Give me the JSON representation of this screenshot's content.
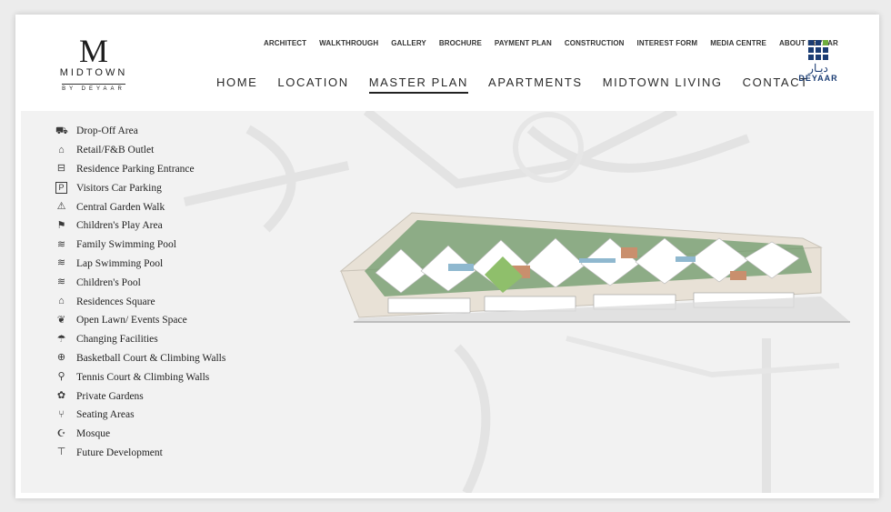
{
  "logo": {
    "mark": "M",
    "word": "MIDTOWN",
    "sub": "BY DEYAAR"
  },
  "top_nav": [
    {
      "label": "ARCHITECT"
    },
    {
      "label": "WALKTHROUGH"
    },
    {
      "label": "GALLERY"
    },
    {
      "label": "BROCHURE"
    },
    {
      "label": "PAYMENT PLAN"
    },
    {
      "label": "CONSTRUCTION"
    },
    {
      "label": "INTEREST FORM"
    },
    {
      "label": "MEDIA CENTRE"
    },
    {
      "label": "ABOUT DEYAAR"
    }
  ],
  "main_nav": [
    {
      "label": "HOME"
    },
    {
      "label": "LOCATION"
    },
    {
      "label": "MASTER PLAN",
      "active": true
    },
    {
      "label": "APARTMENTS"
    },
    {
      "label": "MIDTOWN LIVING"
    },
    {
      "label": "CONTACT"
    }
  ],
  "brand": {
    "arabic": "ديـار",
    "name": "DEYAAR",
    "primary_color": "#1a3c73",
    "accent_color": "#6fae3d"
  },
  "legend": [
    {
      "icon": "car-icon",
      "glyph": "⛟",
      "label": "Drop-Off Area"
    },
    {
      "icon": "shopping-bag-icon",
      "glyph": "⌂",
      "label": "Retail/F&B Outlet"
    },
    {
      "icon": "barrier-icon",
      "glyph": "⊟",
      "label": "Residence Parking Entrance"
    },
    {
      "icon": "parking-icon",
      "glyph": "P",
      "label": "Visitors Car Parking"
    },
    {
      "icon": "tree-icon",
      "glyph": "⚠",
      "label": "Central Garden Walk"
    },
    {
      "icon": "running-child-icon",
      "glyph": "⚑",
      "label": "Children's Play Area"
    },
    {
      "icon": "waves-icon",
      "glyph": "≋",
      "label": "Family Swimming Pool"
    },
    {
      "icon": "waves-icon",
      "glyph": "≋",
      "label": "Lap Swimming Pool"
    },
    {
      "icon": "waves-icon",
      "glyph": "≋",
      "label": "Children's Pool"
    },
    {
      "icon": "house-icon",
      "glyph": "⌂",
      "label": "Residences Square"
    },
    {
      "icon": "leaf-icon",
      "glyph": "❦",
      "label": "Open Lawn/ Events Space"
    },
    {
      "icon": "shower-icon",
      "glyph": "☂",
      "label": "Changing Facilities"
    },
    {
      "icon": "basketball-icon",
      "glyph": "⊕",
      "label": "Basketball Court & Climbing Walls"
    },
    {
      "icon": "tennis-racket-icon",
      "glyph": "⚲",
      "label": "Tennis Court & Climbing Walls"
    },
    {
      "icon": "flower-icon",
      "glyph": "✿",
      "label": "Private Gardens"
    },
    {
      "icon": "bench-icon",
      "glyph": "⑂",
      "label": "Seating Areas"
    },
    {
      "icon": "crescent-icon",
      "glyph": "☪",
      "label": "Mosque"
    },
    {
      "icon": "crane-icon",
      "glyph": "⊤",
      "label": "Future Development"
    }
  ],
  "colors": {
    "map_bg": "#f2f2f2",
    "plan_base": "#e8e1d6",
    "greenery": "#6f9a6b",
    "building": "#ffffff",
    "pool": "#8fb8cf",
    "court": "#c98f6d"
  }
}
